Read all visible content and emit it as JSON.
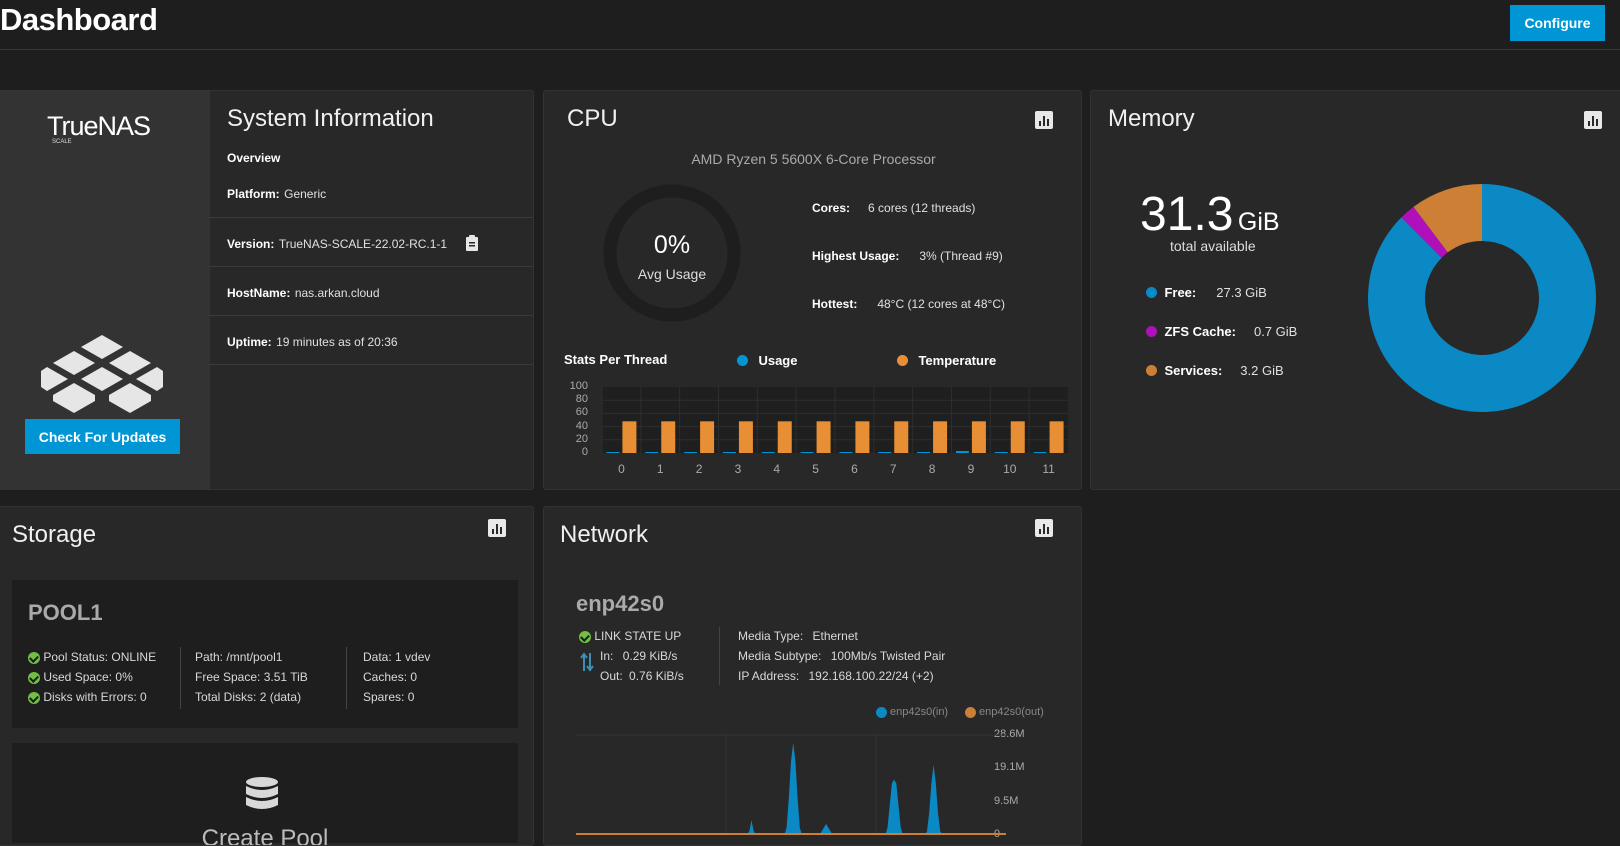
{
  "header": {
    "title": "Dashboard",
    "configure_label": "Configure"
  },
  "sysinfo": {
    "logo_text": "TrueNAS",
    "logo_sub": "SCALE",
    "title": "System Information",
    "overview": "Overview",
    "platform_label": "Platform:",
    "platform": "Generic",
    "version_label": "Version:",
    "version": "TrueNAS-SCALE-22.02-RC.1-1",
    "hostname_label": "HostName:",
    "hostname": "nas.arkan.cloud",
    "uptime_label": "Uptime:",
    "uptime": "19 minutes as of 20:36",
    "update_label": "Check For Updates"
  },
  "cpu": {
    "title": "CPU",
    "model": "AMD Ryzen 5 5600X 6-Core Processor",
    "avg_value": "0%",
    "avg_label": "Avg Usage",
    "cores_label": "Cores:",
    "cores": "6 cores  (12 threads)",
    "highest_label": "Highest Usage:",
    "highest": "3%  (Thread #9)",
    "hottest_label": "Hottest:",
    "hottest": "48°C  (12 cores at 48°C)",
    "stats_title": "Stats Per Thread",
    "legend_usage": "Usage",
    "legend_temp": "Temperature",
    "colors": {
      "usage": "#0095d5",
      "temp": "#e88e34"
    }
  },
  "memory": {
    "title": "Memory",
    "total_value": "31.3",
    "total_unit": "GiB",
    "total_label": "total available",
    "items": [
      {
        "label": "Free:",
        "value": "27.3 GiB",
        "color": "#0a89c4"
      },
      {
        "label": "ZFS Cache:",
        "value": "0.7 GiB",
        "color": "#b10fb9"
      },
      {
        "label": "Services:",
        "value": "3.2 GiB",
        "color": "#cc7f35"
      }
    ]
  },
  "storage": {
    "title": "Storage",
    "pool_name": "POOL1",
    "pool_status_label": "Pool Status:",
    "pool_status": "ONLINE",
    "used_label": "Used Space:",
    "used": "0%",
    "errors_label": "Disks with Errors:",
    "errors": "0",
    "path_label": "Path:",
    "path": "/mnt/pool1",
    "free_label": "Free Space:",
    "free": "3.51 TiB",
    "total_disks_label": "Total Disks:",
    "total_disks": "2 (data)",
    "data_label": "Data:",
    "data": "1 vdev",
    "caches_label": "Caches:",
    "caches": "0",
    "spares_label": "Spares:",
    "spares": "0",
    "create_pool": "Create Pool"
  },
  "network": {
    "title": "Network",
    "iface": "enp42s0",
    "link_state": "LINK STATE UP",
    "in_label": "In:",
    "in": "0.29 KiB/s",
    "out_label": "Out:",
    "out": "0.76 KiB/s",
    "media_type_label": "Media Type:",
    "media_type": "Ethernet",
    "media_subtype_label": "Media Subtype:",
    "media_subtype": "100Mb/s Twisted Pair",
    "ip_label": "IP Address:",
    "ip": "192.168.100.22/24 (+2)",
    "legend_in": "enp42s0(in)",
    "legend_out": "enp42s0(out)",
    "colors": {
      "in": "#0a89c4",
      "out": "#cc7f35"
    }
  },
  "chart_data": [
    {
      "type": "bar",
      "categories": [
        "0",
        "1",
        "2",
        "3",
        "4",
        "5",
        "6",
        "7",
        "8",
        "9",
        "10",
        "11"
      ],
      "series": [
        {
          "name": "Usage",
          "values": [
            1,
            0,
            1,
            1,
            0,
            1,
            1,
            0,
            1,
            3,
            0,
            0
          ]
        },
        {
          "name": "Temperature",
          "values": [
            48,
            48,
            48,
            48,
            48,
            48,
            48,
            48,
            48,
            48,
            48,
            48
          ]
        }
      ],
      "yticks": [
        "100",
        "80",
        "60",
        "40",
        "20",
        "0"
      ],
      "ylim": [
        0,
        100
      ]
    },
    {
      "type": "pie",
      "categories": [
        "Free:",
        "ZFS Cache:",
        "Services:"
      ],
      "values": [
        27.3,
        0.7,
        3.2
      ]
    },
    {
      "type": "area",
      "yticks": [
        "28.6M",
        "19.1M",
        "9.5M",
        "0"
      ],
      "series": [
        {
          "name": "enp42s0(in)",
          "values": [
            0,
            0,
            0,
            0,
            0,
            0,
            0,
            0,
            0,
            0,
            0,
            0,
            0,
            0,
            0,
            0,
            0,
            0,
            0,
            0,
            0,
            0,
            0,
            0,
            0,
            0,
            0,
            0,
            0,
            0,
            0,
            0,
            0,
            0,
            0,
            0,
            0,
            0,
            0,
            0,
            0,
            0,
            0,
            0,
            0,
            0,
            0,
            0,
            0,
            0,
            0,
            0,
            0,
            0,
            0,
            0,
            0,
            0,
            0,
            0,
            0,
            0,
            0,
            0,
            0,
            0,
            0,
            0,
            0,
            0,
            0,
            0,
            0,
            0,
            0,
            0,
            0,
            0,
            0,
            1,
            4,
            1,
            0,
            0,
            0,
            0,
            0,
            0,
            0,
            0,
            0,
            0,
            0,
            0,
            0,
            0,
            2,
            10,
            20,
            25,
            20,
            10,
            2,
            0,
            0,
            0,
            0,
            0,
            0,
            0,
            0,
            0,
            1,
            2,
            3,
            2,
            1,
            0,
            0,
            0,
            0,
            0,
            0,
            0,
            0,
            0,
            0,
            0,
            0,
            0,
            0,
            0,
            0,
            0,
            0,
            0,
            0,
            0,
            0,
            0,
            0,
            0,
            2,
            8,
            14,
            15,
            14,
            8,
            2,
            0,
            0,
            0,
            0,
            0,
            0,
            0,
            0,
            0,
            0,
            0,
            1,
            6,
            14,
            19,
            14,
            6,
            1,
            0,
            0,
            0,
            0,
            0,
            0,
            0,
            0,
            0,
            0,
            0,
            0,
            0,
            0,
            0,
            0,
            0,
            0,
            0,
            0,
            0,
            0,
            0,
            0,
            0,
            0,
            0,
            0,
            0,
            0
          ]
        },
        {
          "name": "enp42s0(out)",
          "values": [
            0,
            0,
            0,
            0,
            0,
            0,
            0,
            0,
            0,
            0,
            0,
            0,
            0,
            0,
            0,
            0,
            0,
            0,
            0,
            0,
            0,
            0,
            0,
            0,
            0,
            0,
            0,
            0,
            0,
            0,
            0,
            0,
            0,
            0,
            0,
            0,
            0,
            0,
            0,
            0,
            0,
            0,
            0,
            0,
            0,
            0,
            0,
            0,
            0,
            0,
            0,
            0,
            0,
            0,
            0,
            0,
            0,
            0,
            0,
            0,
            0,
            0,
            0,
            0,
            0,
            0,
            0,
            0,
            0,
            0,
            0,
            0,
            0,
            0,
            0,
            0,
            0,
            0,
            0,
            0,
            0,
            0,
            0,
            0,
            0,
            0,
            0,
            0,
            0,
            0,
            0,
            0,
            0,
            0,
            0,
            0,
            0,
            0,
            0,
            0,
            0,
            0,
            0,
            0,
            0,
            0,
            0,
            0,
            0,
            0,
            0,
            0,
            0,
            0,
            0,
            0,
            0,
            0,
            0,
            0,
            0,
            0,
            0,
            0,
            0,
            0,
            0,
            0,
            0,
            0,
            0,
            0,
            0,
            0,
            0,
            0,
            0,
            0,
            0,
            0,
            0,
            0,
            0,
            0,
            0,
            0,
            0,
            0,
            0,
            0,
            0,
            0,
            0,
            0,
            0,
            0,
            0,
            0,
            0,
            0,
            0,
            0,
            0,
            0,
            0,
            0,
            0,
            0,
            0,
            0,
            0,
            0,
            0,
            0,
            0,
            0,
            0,
            0,
            0,
            0,
            0,
            0,
            0,
            0,
            0,
            0,
            0,
            0,
            0,
            0,
            0,
            0,
            0,
            0,
            0,
            0,
            0,
            0,
            0,
            0
          ]
        }
      ]
    }
  ]
}
